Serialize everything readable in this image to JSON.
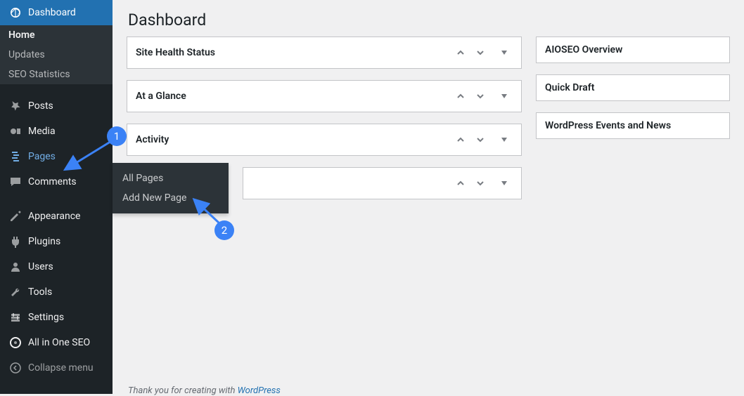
{
  "sidebar": {
    "primary": {
      "dashboard": "Dashboard",
      "posts": "Posts",
      "media": "Media",
      "pages": "Pages",
      "comments": "Comments",
      "appearance": "Appearance",
      "plugins": "Plugins",
      "users": "Users",
      "tools": "Tools",
      "settings": "Settings",
      "aioseo": "All in One SEO",
      "collapse": "Collapse menu"
    },
    "dashboard_sub": {
      "home": "Home",
      "updates": "Updates",
      "seo_stats": "SEO Statistics"
    }
  },
  "flyout": {
    "all_pages": "All Pages",
    "add_new": "Add New Page"
  },
  "page": {
    "title": "Dashboard"
  },
  "boxes": {
    "site_health": "Site Health Status",
    "at_a_glance": "At a Glance",
    "activity": "Activity",
    "empty": "",
    "aioseo": "AIOSEO Overview",
    "quick_draft": "Quick Draft",
    "events": "WordPress Events and News"
  },
  "footer": {
    "prefix": "Thank you for creating with ",
    "link": "WordPress"
  },
  "annotations": {
    "one": "1",
    "two": "2"
  }
}
